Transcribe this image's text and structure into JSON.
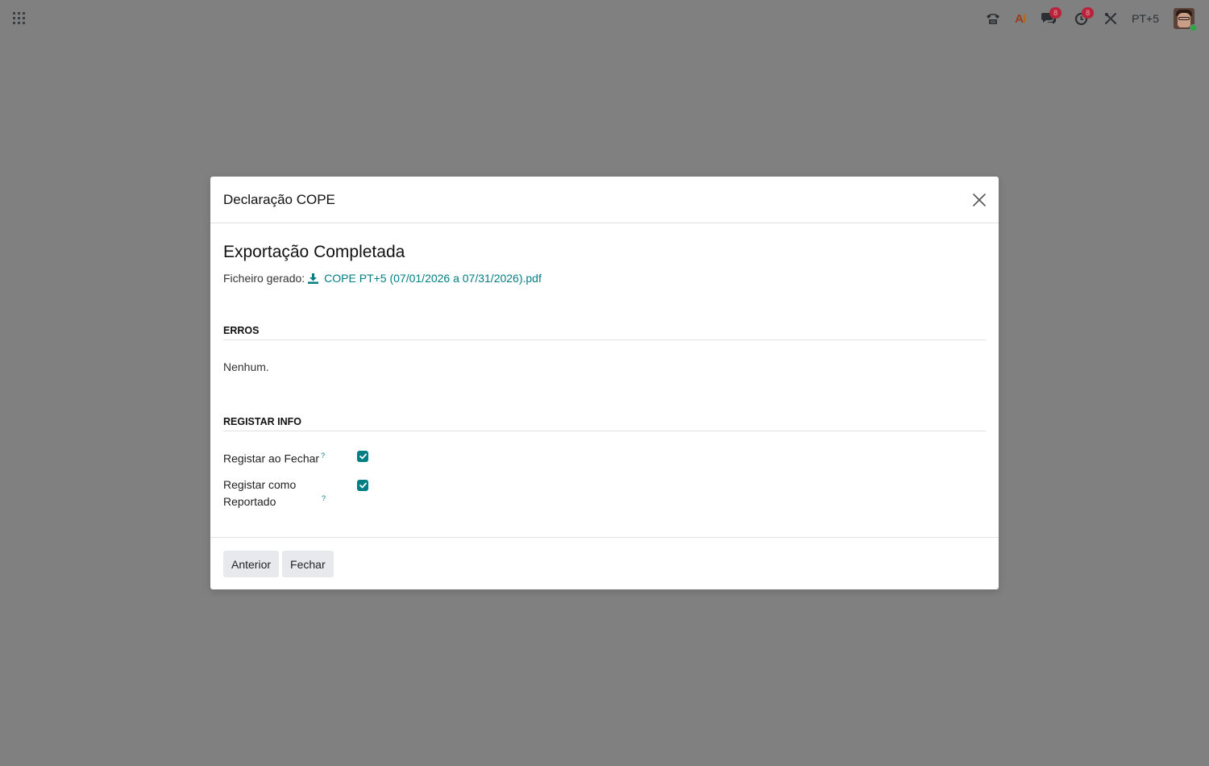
{
  "navbar": {
    "apps_icon": "grid-icon",
    "systray": {
      "phone_icon": "phone-icon",
      "ai_label_a": "A",
      "ai_label_i": "I",
      "messages_badge": "8",
      "activities_badge": "8",
      "company_label": "PT+5"
    }
  },
  "modal": {
    "title": "Declaração COPE",
    "export_title": "Exportação Completada",
    "file_label": "Ficheiro gerado:",
    "file_name": "COPE PT+5 (07/01/2026 a 07/31/2026).pdf",
    "errors_title": "ERROS",
    "errors_text": "Nenhum.",
    "info_title": "REGISTAR INFO",
    "fields": [
      {
        "label": "Registar ao Fechar",
        "checked": true
      },
      {
        "label": "Registar como Reportado",
        "checked": true
      }
    ],
    "help_mark": "?",
    "buttons": {
      "previous": "Anterior",
      "close": "Fechar"
    }
  },
  "colors": {
    "accent": "#017e84",
    "backdrop": "#808080",
    "badge": "#b8233a"
  }
}
